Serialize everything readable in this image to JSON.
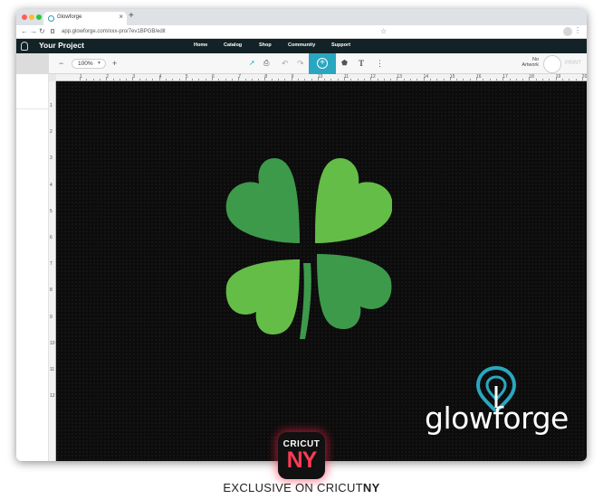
{
  "browser": {
    "tab_title": "Glowforge",
    "url": "app.glowforge.com/xxx-pro/7ev1BPGB/edit"
  },
  "app": {
    "project_title": "Your Project",
    "nav": [
      "Home",
      "Catalog",
      "Shop",
      "Community",
      "Support"
    ]
  },
  "toolbar": {
    "zoom": "100%",
    "text_tool": "T",
    "status_line1": "No",
    "status_line2": "Artwork",
    "print_label": "PRINT"
  },
  "ruler": {
    "h_ticks": [
      "1",
      "2",
      "3",
      "4",
      "5",
      "6",
      "7",
      "8",
      "9",
      "10",
      "11",
      "12",
      "13",
      "14",
      "15",
      "16",
      "17",
      "18",
      "19",
      "20"
    ],
    "v_ticks": [
      "1",
      "2",
      "3",
      "4",
      "5",
      "6",
      "7",
      "8",
      "9",
      "10",
      "11",
      "12"
    ]
  },
  "artwork": {
    "brand": "glowforge",
    "leaf_dark": "#3d9a4b",
    "leaf_light": "#64bd47",
    "accent": "#2aa7c0"
  },
  "badge": {
    "top": "CRICUT",
    "bottom": "NY"
  },
  "caption": {
    "prefix": "EXCLUSIVE ON CRICUT",
    "suffix": "NY"
  }
}
